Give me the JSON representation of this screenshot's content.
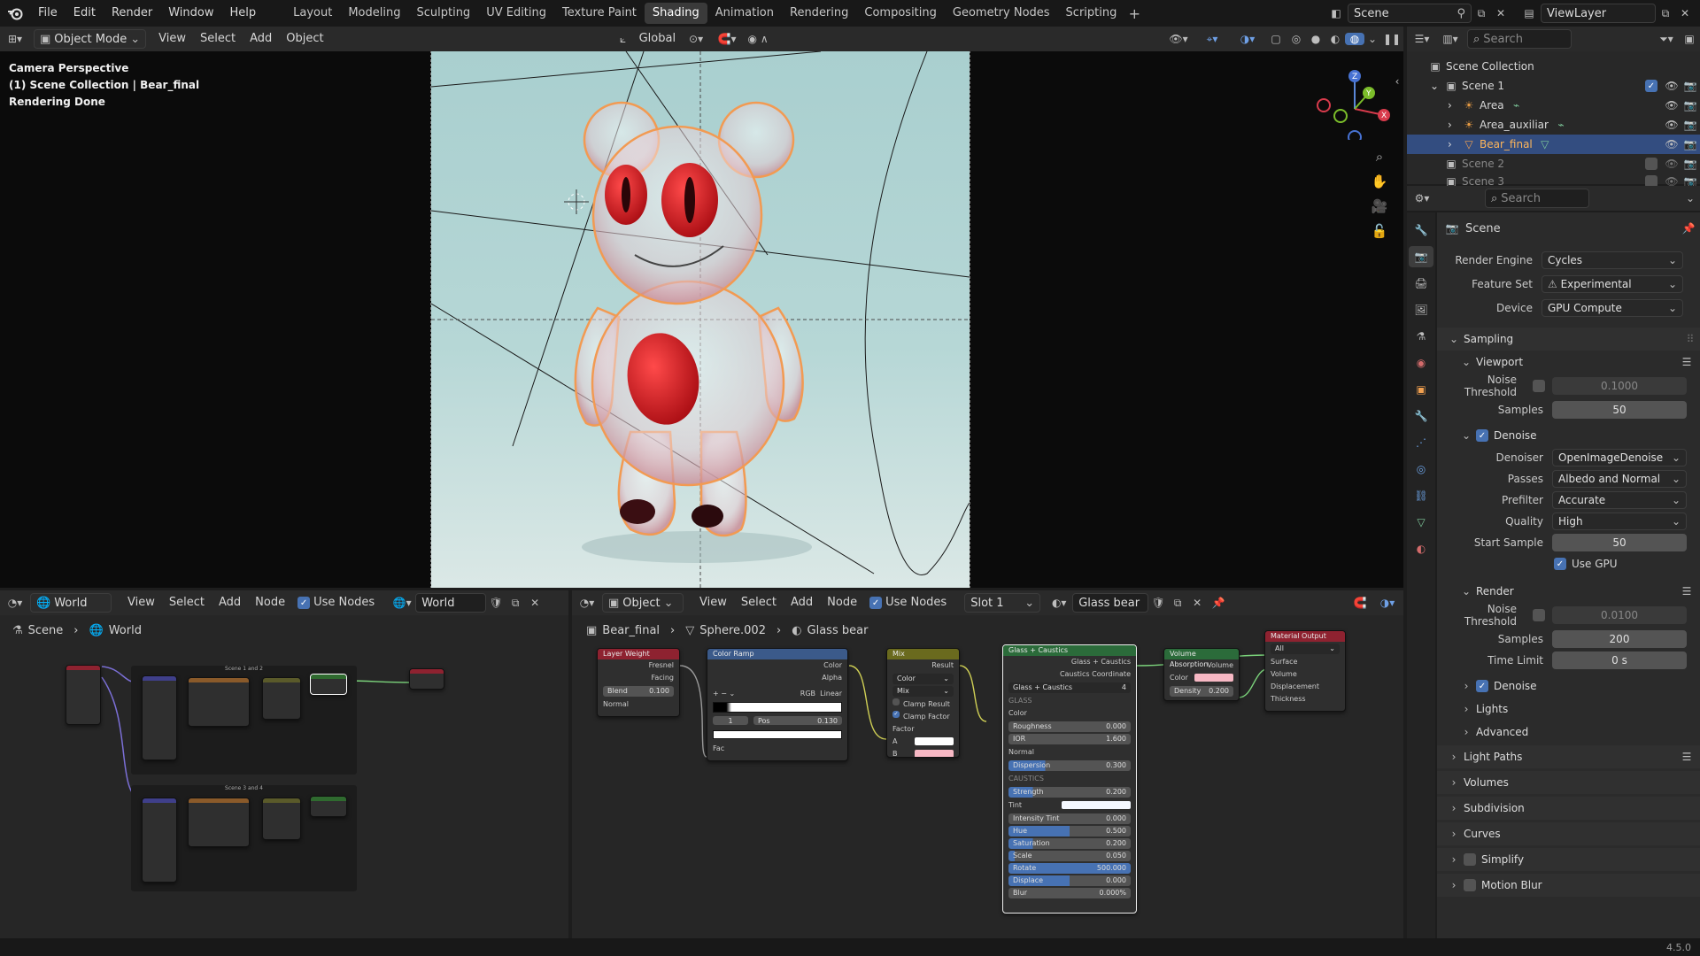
{
  "topbar": {
    "menus": [
      "File",
      "Edit",
      "Render",
      "Window",
      "Help"
    ],
    "workspaces": [
      "Layout",
      "Modeling",
      "Sculpting",
      "UV Editing",
      "Texture Paint",
      "Shading",
      "Animation",
      "Rendering",
      "Compositing",
      "Geometry Nodes",
      "Scripting"
    ],
    "active_workspace": "Shading",
    "scene": "Scene",
    "view_layer": "ViewLayer"
  },
  "viewport": {
    "mode": "Object Mode",
    "menus": [
      "View",
      "Select",
      "Add",
      "Object"
    ],
    "transform": "Global",
    "overlay": [
      "Camera Perspective",
      "(1) Scene Collection | Bear_final",
      "Rendering Done"
    ]
  },
  "outliner": {
    "search_placeholder": "Search",
    "root": "Scene Collection",
    "items": [
      {
        "label": "Scene 1",
        "level": 1
      },
      {
        "label": "Area",
        "level": 2
      },
      {
        "label": "Area_auxiliar",
        "level": 2
      },
      {
        "label": "Bear_final",
        "level": 2
      },
      {
        "label": "Scene 2",
        "level": 1
      },
      {
        "label": "Scene 3",
        "level": 1
      }
    ]
  },
  "properties": {
    "search_placeholder": "Search",
    "title": "Scene",
    "render_engine_label": "Render Engine",
    "render_engine": "Cycles",
    "feature_set_label": "Feature Set",
    "feature_set": "Experimental",
    "device_label": "Device",
    "device": "GPU Compute",
    "sampling": "Sampling",
    "viewport": "Viewport",
    "noise_threshold_label": "Noise Threshold",
    "vp_noise_threshold": "0.1000",
    "samples_label": "Samples",
    "vp_samples": "50",
    "denoise": "Denoise",
    "denoiser_label": "Denoiser",
    "denoiser": "OpenImageDenoise",
    "passes_label": "Passes",
    "passes": "Albedo and Normal",
    "prefilter_label": "Prefilter",
    "prefilter": "Accurate",
    "quality_label": "Quality",
    "quality": "High",
    "start_sample_label": "Start Sample",
    "start_sample": "50",
    "use_gpu": "Use GPU",
    "render": "Render",
    "r_noise_threshold": "0.0100",
    "r_samples": "200",
    "time_limit_label": "Time Limit",
    "time_limit": "0 s",
    "r_denoise": "Denoise",
    "lights": "Lights",
    "advanced": "Advanced",
    "light_paths": "Light Paths",
    "volumes": "Volumes",
    "subdivision": "Subdivision",
    "curves": "Curves",
    "simplify": "Simplify",
    "motion_blur": "Motion Blur"
  },
  "world_editor": {
    "type": "World",
    "menus": [
      "View",
      "Select",
      "Add",
      "Node"
    ],
    "use_nodes": "Use Nodes",
    "datablock": "World",
    "breadcrumb": [
      "Scene",
      "World"
    ],
    "frame1": "Scene 1 and 2",
    "frame2": "Scene 3 and 4"
  },
  "shader_editor": {
    "type": "Object",
    "menus": [
      "View",
      "Select",
      "Add",
      "Node"
    ],
    "use_nodes": "Use Nodes",
    "slot": "Slot 1",
    "material": "Glass bear",
    "breadcrumb": [
      "Bear_final",
      "Sphere.002",
      "Glass bear"
    ],
    "layer_weight": {
      "title": "Layer Weight",
      "out1": "Fresnel",
      "out2": "Facing",
      "blend_label": "Blend",
      "blend": "0.100",
      "normal": "Normal"
    },
    "color_ramp": {
      "title": "Color Ramp",
      "out1": "Color",
      "out2": "Alpha",
      "mode": "RGB",
      "interp": "Linear",
      "index": "1",
      "pos_label": "Pos",
      "pos": "0.130",
      "fac": "Fac"
    },
    "mix": {
      "title": "Mix",
      "result": "Result",
      "type": "Color",
      "blend": "Mix",
      "clamp_result": "Clamp Result",
      "clamp_factor": "Clamp Factor",
      "factor": "Factor",
      "a": "A",
      "b": "B",
      "b_color": "#f7b8c4"
    },
    "glass": {
      "title": "Glass + Caustics",
      "out1": "Glass + Caustics",
      "out2": "Caustics Coordinate",
      "group": "Glass + Caustics",
      "users": "4",
      "section_glass": "GLASS",
      "section_caustics": "CAUSTICS",
      "fields": [
        {
          "label": "Color",
          "value": "",
          "kind": "socket"
        },
        {
          "label": "Roughness",
          "value": "0.000",
          "fill": 0
        },
        {
          "label": "IOR",
          "value": "1.600",
          "fill": 0
        },
        {
          "label": "Normal",
          "value": "",
          "kind": "socket"
        },
        {
          "label": "Dispersion",
          "value": "0.300",
          "fill": 30
        }
      ],
      "fields2": [
        {
          "label": "Strength",
          "value": "0.200",
          "fill": 20
        },
        {
          "label": "Tint",
          "value": "",
          "kind": "color"
        },
        {
          "label": "Intensity Tint",
          "value": "0.000",
          "fill": 0
        },
        {
          "label": "Hue",
          "value": "0.500",
          "fill": 50
        },
        {
          "label": "Saturation",
          "value": "0.200",
          "fill": 20
        },
        {
          "label": "Scale",
          "value": "0.050",
          "fill": 5
        },
        {
          "label": "Rotate",
          "value": "500.000",
          "fill": 100
        },
        {
          "label": "Displace",
          "value": "0.000",
          "fill": 50
        },
        {
          "label": "Blur",
          "value": "0.000%",
          "fill": 0
        }
      ]
    },
    "volume_absorption": {
      "title": "Volume Absorption",
      "out": "Volume",
      "color_label": "Color",
      "color": "#f7b8c4",
      "density_label": "Density",
      "density": "0.200"
    },
    "material_output": {
      "title": "Material Output",
      "target": "All",
      "inputs": [
        "Surface",
        "Volume",
        "Displacement",
        "Thickness"
      ]
    }
  },
  "status": {
    "version": "4.5.0"
  }
}
